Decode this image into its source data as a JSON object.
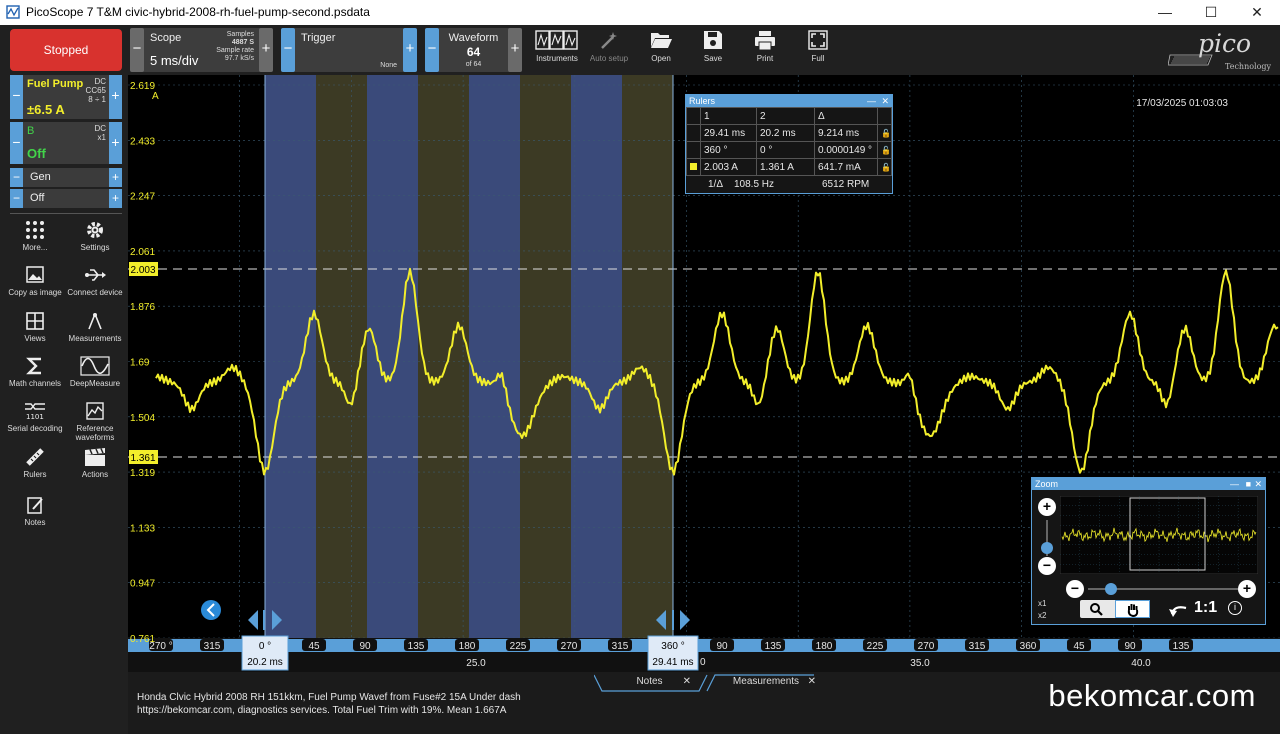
{
  "window": {
    "title": "PicoScope 7 T&M civic-hybrid-2008-rh-fuel-pump-second.psdata",
    "min": "—",
    "max": "☐",
    "close": "✕"
  },
  "left": {
    "stopped": "Stopped",
    "channelA": {
      "name": "Fuel Pump",
      "value": "±6.5 A",
      "info1": "DC",
      "info2": "CC65",
      "info3": "8 ÷ 1"
    },
    "channelB": {
      "name": "B",
      "value": "Off",
      "info1": "DC",
      "info2": "x1"
    },
    "gen": {
      "label": "Gen",
      "value": "Off"
    },
    "tools": [
      {
        "label": "More..."
      },
      {
        "label": "Settings"
      },
      {
        "label": "Copy as image"
      },
      {
        "label": "Connect device"
      },
      {
        "label": "Views"
      },
      {
        "label": "Measurements"
      },
      {
        "label": "Math channels"
      },
      {
        "label": "DeepMeasure"
      },
      {
        "label": "Serial decoding"
      },
      {
        "label": "Reference waveforms"
      },
      {
        "label": "Rulers"
      },
      {
        "label": "Actions"
      },
      {
        "label": "Notes"
      }
    ]
  },
  "toolbar": {
    "scope": {
      "label": "Scope",
      "value": "5 ms/div",
      "samples_label": "Samples",
      "samples": "4887 S",
      "rate_label": "Sample rate",
      "rate": "97.7 kS/s"
    },
    "trigger": {
      "label": "Trigger",
      "mode": "None"
    },
    "waveform": {
      "label": "Waveform",
      "value": "64",
      "of": "of 64"
    },
    "buttons": [
      "Instruments",
      "Auto setup",
      "Open",
      "Save",
      "Print",
      "Full"
    ],
    "logo_text": "pico",
    "logo_sub": "Technology"
  },
  "scope": {
    "timestamp": "17/03/2025 01:03:03",
    "y_unit": "A",
    "y_ticks": [
      "2.619",
      "2.433",
      "2.247",
      "2.061",
      "1.876",
      "1.69",
      "1.504",
      "1.319",
      "1.133",
      "0.947",
      "0.761"
    ],
    "ruler_labels": [
      "2.003",
      "1.361"
    ],
    "x_ticks": [
      "25.0",
      "",
      "35.0",
      "40.0"
    ],
    "x_partial": "0",
    "phase_labels": [
      "270 °",
      "315",
      "45",
      "90",
      "135",
      "180",
      "225",
      "270",
      "315",
      "45",
      "90",
      "135",
      "180",
      "225",
      "270",
      "315",
      "360",
      "45",
      "90",
      "135"
    ],
    "cursor1": {
      "deg": "0 °",
      "time": "20.2 ms"
    },
    "cursor2": {
      "deg": "360 °",
      "time": "29.41 ms"
    }
  },
  "rulers": {
    "title": "Rulers",
    "headers": [
      "1",
      "2",
      "Δ"
    ],
    "rows": [
      [
        "29.41 ms",
        "20.2 ms",
        "9.214 ms"
      ],
      [
        "360 °",
        "0 °",
        "0.0000149 °"
      ],
      [
        "2.003 A",
        "1.361 A",
        "641.7 mA"
      ]
    ],
    "inv_label": "1/Δ",
    "freq": "108.5 Hz",
    "rpm": "6512 RPM"
  },
  "zoom": {
    "title": "Zoom",
    "x1": "x1",
    "x2": "x2",
    "ratio": "1:1"
  },
  "bottom": {
    "desc_line1": "Honda Clvic Hybrid 2008 RH 151kkm, Fuel Pump Wavef from Fuse#2 15A Under dash",
    "desc_line2": "https://bekomcar.com, diagnostics services. Total Fuel Trim with 19%.  Mean 1.667A",
    "tabs": [
      "Notes",
      "Measurements"
    ],
    "brand": "bekomcar.com"
  },
  "colors": {
    "trace": "#f2ee2b",
    "accent": "#5a9fd8",
    "stopped": "#d8322e",
    "band_blue": "#3a4a7a",
    "band_olive": "#3c3a24"
  }
}
